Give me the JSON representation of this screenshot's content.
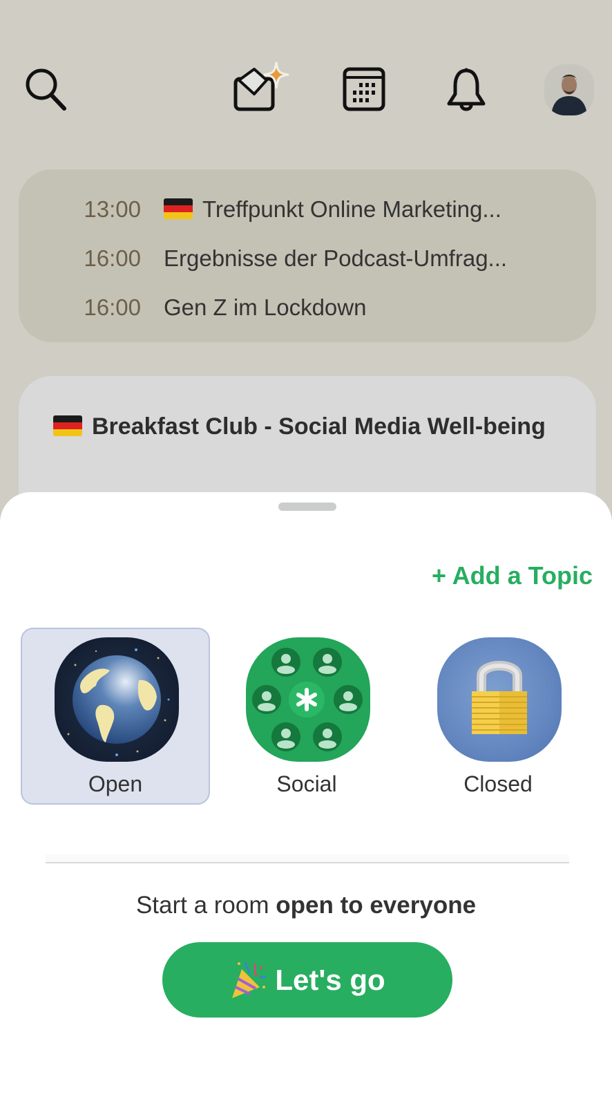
{
  "topbar": {
    "search_icon": "search-icon",
    "invite_icon": "envelope-sparkle-icon",
    "calendar_icon": "calendar-icon",
    "notifications_icon": "bell-icon",
    "profile_avatar": "user-avatar",
    "accent_color": "#e89a3c"
  },
  "upcoming": {
    "events": [
      {
        "time": "13:00",
        "flag": "de",
        "title": "Treffpunkt Online Marketing..."
      },
      {
        "time": "16:00",
        "flag": "",
        "title": "Ergebnisse der Podcast-Umfrag..."
      },
      {
        "time": "16:00",
        "flag": "",
        "title": "Gen Z im Lockdown"
      }
    ]
  },
  "room_card": {
    "flag": "de",
    "title": "Breakfast Club - Social Media Well-being"
  },
  "sheet": {
    "add_topic_label": "+ Add a Topic",
    "room_types": [
      {
        "label": "Open",
        "icon": "globe-icon",
        "selected": true
      },
      {
        "label": "Social",
        "icon": "social-group-icon",
        "selected": false
      },
      {
        "label": "Closed",
        "icon": "padlock-icon",
        "selected": false
      }
    ],
    "caption_prefix": "Start a room ",
    "caption_bold": "open to everyone",
    "go_button_label": "Let's go",
    "go_button_icon": "party-popper-icon",
    "brand_color": "#27ae60"
  }
}
